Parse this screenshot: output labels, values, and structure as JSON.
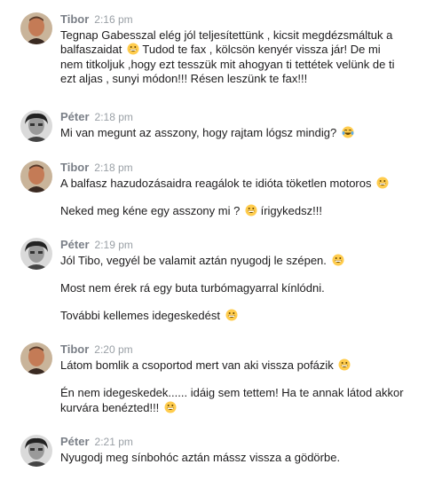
{
  "messages": [
    {
      "author": "Tibor",
      "time": "2:16 pm",
      "avatar": "tibor",
      "lines": [
        "Tegnap Gabesszal elég jól teljesítettünk , kicsit megdézsmáltuk a",
        "balfaszaidat",
        "Tudod te fax , kölcsön kenyér vissza jár! De mi",
        "nem titkoljuk ,hogy ezt tesszük mit ahogyan ti tettétek velünk de ti",
        "ezt aljas , sunyi módon!!! Résen leszünk te fax!!!"
      ]
    },
    {
      "author": "Péter",
      "time": "2:18 pm",
      "avatar": "peter",
      "lines": [
        "Mi van megunt az asszony, hogy rajtam lógsz mindig?"
      ]
    },
    {
      "author": "Tibor",
      "time": "2:18 pm",
      "avatar": "tibor",
      "lines": [
        "A balfasz hazudozásaidra reagálok te idióta töketlen motoros",
        "Neked meg kéne egy asszony mi ?",
        "írigykedsz!!!"
      ]
    },
    {
      "author": "Péter",
      "time": "2:19 pm",
      "avatar": "peter",
      "lines": [
        "Jól Tibo, vegyél be valamit aztán nyugodj le szépen.",
        "Most nem érek rá egy buta turbómagyarral kínlódni.",
        "További kellemes idegeskedést"
      ]
    },
    {
      "author": "Tibor",
      "time": "2:20 pm",
      "avatar": "tibor",
      "lines": [
        "Látom bomlik a csoportod mert van aki vissza pofázik",
        "Én nem idegeskedek...... idáig sem tettem! Ha te annak látod akkor",
        "kurvára benézted!!!"
      ]
    },
    {
      "author": "Péter",
      "time": "2:21 pm",
      "avatar": "peter",
      "lines": [
        "Nyugodj meg sínbohóc aztán mássz vissza a gödörbe."
      ]
    }
  ],
  "colors": {
    "text": "#1d1c1d",
    "timestamp": "#9aa0a6",
    "emoji_face": "#ffcc4d"
  },
  "icons": {
    "grin": "grinning-face-emoji",
    "laugh": "tears-of-joy-emoji"
  }
}
